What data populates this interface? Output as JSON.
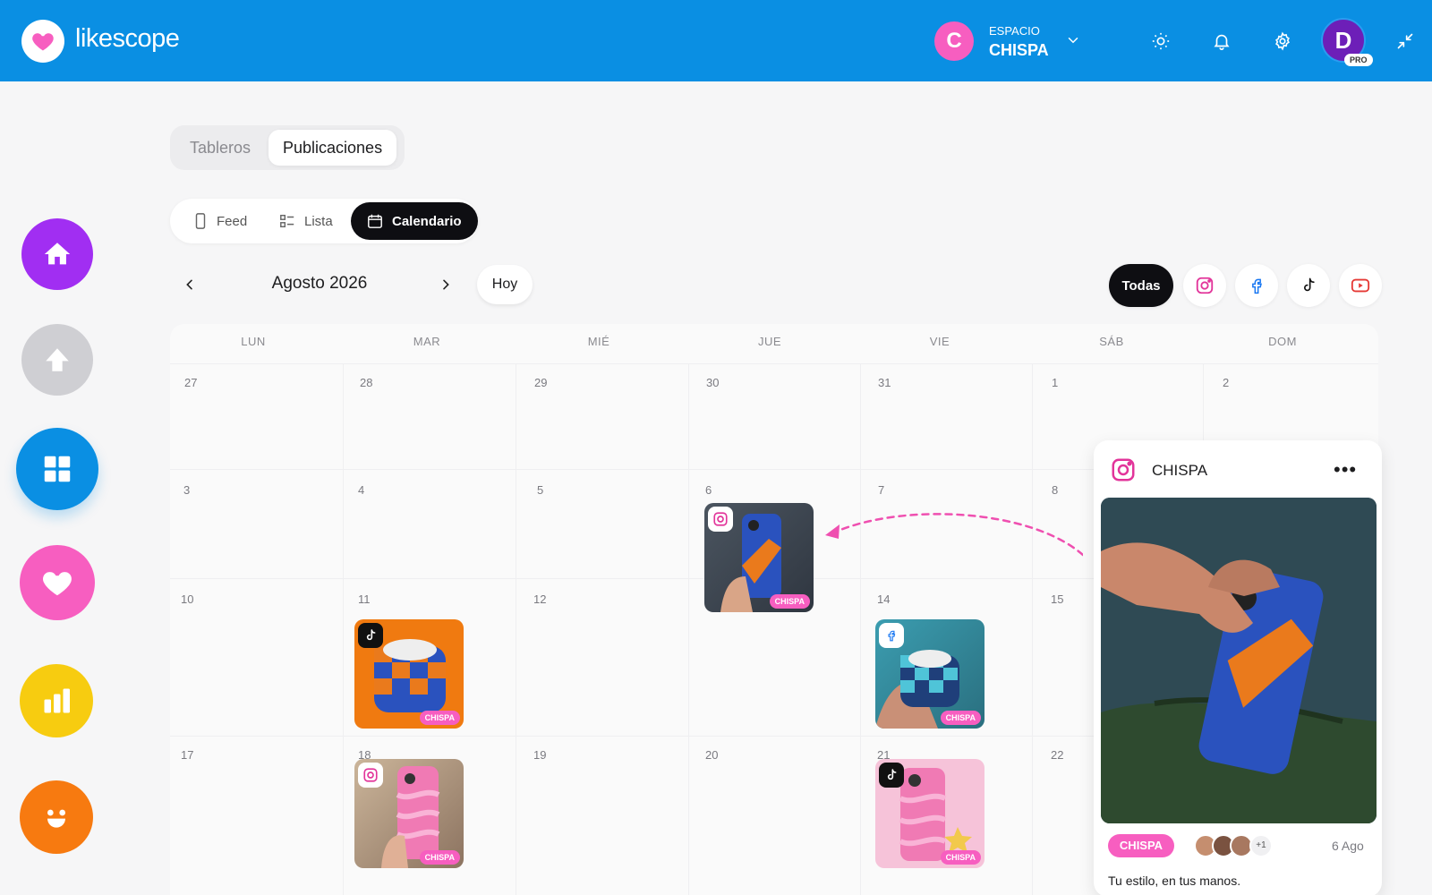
{
  "header": {
    "brand": "likescope",
    "workspace": {
      "initial": "C",
      "label": "ESPACIO",
      "name": "CHISPA"
    },
    "user": {
      "initial": "D",
      "badge": "PRO"
    },
    "icons": [
      "sun-icon",
      "bell-icon",
      "gear-icon",
      "collapse-icon"
    ]
  },
  "sidebar": {
    "items": [
      {
        "name": "home",
        "icon": "home-icon",
        "color": "#a12ef2"
      },
      {
        "name": "upload",
        "icon": "upload-icon",
        "color": "#cfcfd3"
      },
      {
        "name": "boards",
        "icon": "grid-icon",
        "color": "#0a8fe3"
      },
      {
        "name": "likes",
        "icon": "heart-icon",
        "color": "#f75ec0"
      },
      {
        "name": "analytics",
        "icon": "bar-chart-icon",
        "color": "#f7cc10"
      },
      {
        "name": "community",
        "icon": "smile-icon",
        "color": "#f77a10"
      }
    ]
  },
  "tabs": {
    "inactive": "Tableros",
    "active": "Publicaciones"
  },
  "views": {
    "feed": "Feed",
    "list": "Lista",
    "calendar": "Calendario",
    "selected": "Calendario"
  },
  "nav": {
    "month": "Agosto 2026",
    "today": "Hoy"
  },
  "filters": {
    "all": "Todas",
    "networks": [
      "instagram-icon",
      "facebook-icon",
      "tiktok-icon",
      "youtube-icon"
    ]
  },
  "calendar": {
    "weekdays": [
      "LUN",
      "MAR",
      "MIÉ",
      "JUE",
      "VIE",
      "SÁB",
      "DOM"
    ],
    "weeks": [
      [
        "27",
        "28",
        "29",
        "30",
        "31",
        "1",
        "2"
      ],
      [
        "3",
        "4",
        "5",
        "6",
        "7",
        "8",
        ""
      ],
      [
        "10",
        "11",
        "12",
        "",
        "14",
        "15",
        ""
      ],
      [
        "17",
        "18",
        "19",
        "20",
        "21",
        "22",
        ""
      ]
    ],
    "posts": [
      {
        "day": "6",
        "network": "instagram",
        "tag": "CHISPA"
      },
      {
        "day": "11",
        "network": "tiktok",
        "tag": "CHISPA"
      },
      {
        "day": "14",
        "network": "facebook",
        "tag": "CHISPA"
      },
      {
        "day": "18",
        "network": "instagram",
        "tag": "CHISPA"
      },
      {
        "day": "21",
        "network": "tiktok",
        "tag": "CHISPA"
      }
    ]
  },
  "preview": {
    "account": "CHISPA",
    "tag": "CHISPA",
    "extra_collaborators": "+1",
    "date": "6 Ago",
    "caption": "Tu estilo, en tus manos."
  },
  "colors": {
    "header": "#0a8fe3",
    "accent": "#f75ec0",
    "dark": "#0e0e12"
  }
}
